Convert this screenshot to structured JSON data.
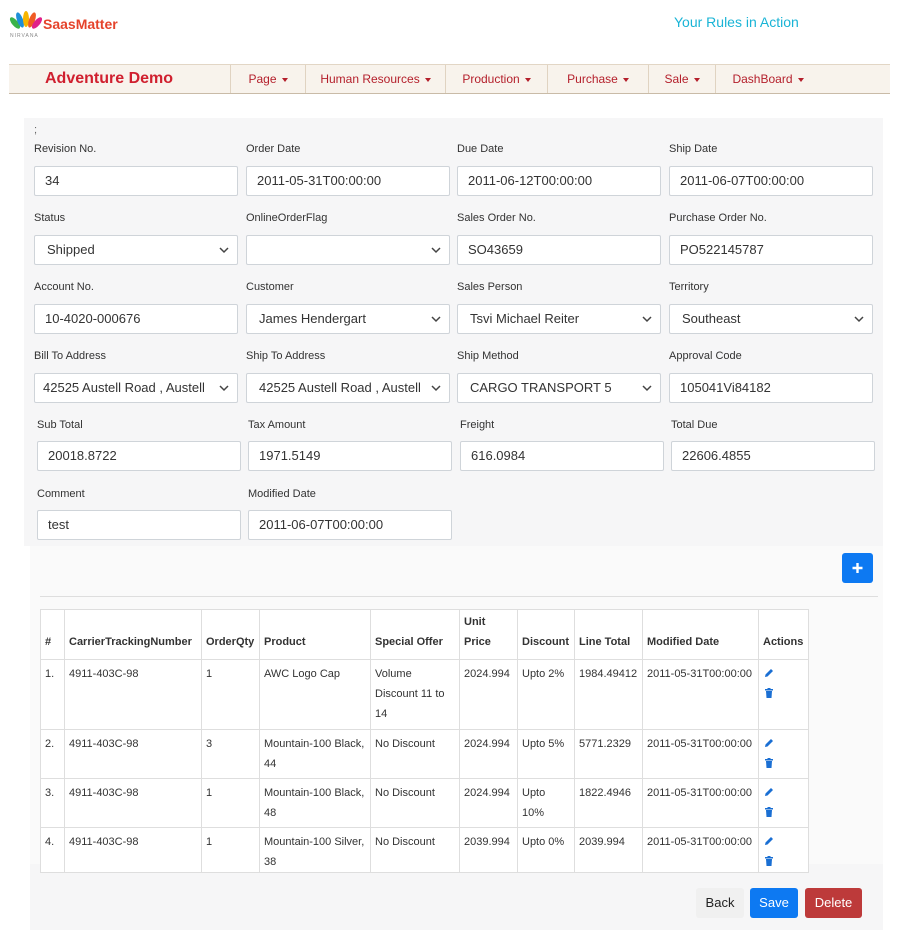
{
  "brand": {
    "name": "SaasMatter",
    "subtitle": "NIRVANA",
    "tagline": "Your Rules in Action"
  },
  "nav": {
    "app_title": "Adventure Demo",
    "items": [
      {
        "label": "Page"
      },
      {
        "label": "Human Resources"
      },
      {
        "label": "Production"
      },
      {
        "label": "Purchase"
      },
      {
        "label": "Sale"
      },
      {
        "label": "DashBoard"
      }
    ]
  },
  "form": {
    "stray_text": ";",
    "fields": [
      {
        "label": "Revision No.",
        "value": "34"
      },
      {
        "label": "Order Date",
        "value": "2011-05-31T00:00:00"
      },
      {
        "label": "Due Date",
        "value": "2011-06-12T00:00:00"
      },
      {
        "label": "Ship Date",
        "value": "2011-06-07T00:00:00"
      },
      {
        "label": "Status",
        "value": "Shipped"
      },
      {
        "label": "OnlineOrderFlag",
        "value": ""
      },
      {
        "label": "Sales Order No.",
        "value": "SO43659"
      },
      {
        "label": "Purchase Order No.",
        "value": "PO522145787"
      },
      {
        "label": "Account No.",
        "value": "10-4020-000676"
      },
      {
        "label": "Customer",
        "value": "James Hendergart"
      },
      {
        "label": "Sales Person",
        "value": "Tsvi Michael Reiter"
      },
      {
        "label": "Territory",
        "value": "Southeast"
      },
      {
        "label": "Bill To Address",
        "value": "42525 Austell Road , Austell"
      },
      {
        "label": "Ship To Address",
        "value": "42525 Austell Road , Austell"
      },
      {
        "label": "Ship Method",
        "value": "CARGO TRANSPORT 5"
      },
      {
        "label": "Approval Code",
        "value": "105041Vi84182"
      },
      {
        "label": "Sub Total",
        "value": "20018.8722"
      },
      {
        "label": "Tax Amount",
        "value": "1971.5149"
      },
      {
        "label": "Freight",
        "value": "616.0984"
      },
      {
        "label": "Total Due",
        "value": "22606.4855"
      },
      {
        "label": "Comment",
        "value": "test"
      },
      {
        "label": "Modified Date",
        "value": "2011-06-07T00:00:00"
      }
    ]
  },
  "table": {
    "headers": [
      "#",
      "CarrierTrackingNumber",
      "OrderQty",
      "Product",
      "Special Offer",
      "Unit Price",
      "Discount",
      "Line Total",
      "Modified Date",
      "Actions"
    ],
    "rows": [
      [
        "1.",
        "4911-403C-98",
        "1",
        "AWC Logo Cap",
        "Volume Discount 11 to 14",
        "2024.994",
        "Upto 2%",
        "1984.49412",
        "2011-05-31T00:00:00"
      ],
      [
        "2.",
        "4911-403C-98",
        "3",
        "Mountain-100 Black, 44",
        "No Discount",
        "2024.994",
        "Upto 5%",
        "5771.2329",
        "2011-05-31T00:00:00"
      ],
      [
        "3.",
        "4911-403C-98",
        "1",
        "Mountain-100 Black, 48",
        "No Discount",
        "2024.994",
        "Upto 10%",
        "1822.4946",
        "2011-05-31T00:00:00"
      ],
      [
        "4.",
        "4911-403C-98",
        "1",
        "Mountain-100 Silver, 38",
        "No Discount",
        "2039.994",
        "Upto 0%",
        "2039.994",
        "2011-05-31T00:00:00"
      ]
    ]
  },
  "buttons": {
    "back": "Back",
    "save": "Save",
    "delete": "Delete"
  },
  "icons": {
    "add": "plus-icon",
    "edit": "pencil-icon",
    "delete": "trash-icon"
  },
  "colors": {
    "brand_red": "#d0202f",
    "tagline_cyan": "#19b4d6",
    "primary_blue": "#0d79f2",
    "danger_red": "#bd3a3a"
  }
}
